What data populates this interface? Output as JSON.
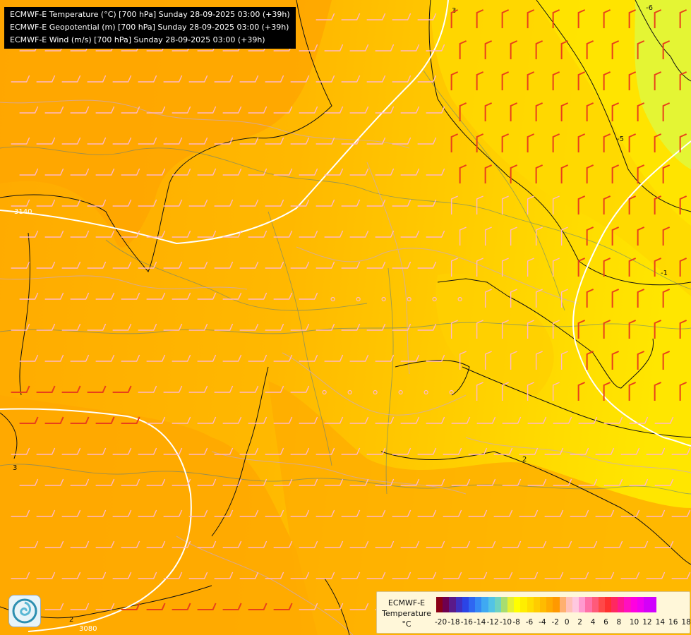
{
  "header": {
    "lines": [
      "ECMWF-E Temperature (°C) [700 hPa] Sunday 28-09-2025 03:00 (+39h)",
      "ECMWF-E Geopotential (m) [700 hPa] Sunday 28-09-2025 03:00 (+39h)",
      "ECMWF-E Wind (m/s) [700 hPa] Sunday 28-09-2025 03:00 (+39h)"
    ]
  },
  "map": {
    "temperature_contour_labels": [
      "3",
      "3",
      "2",
      "2",
      "-1",
      "-5",
      "-6"
    ],
    "geopotential_contour_labels": [
      "3140",
      "3080"
    ],
    "colors": {
      "warm_orange": "#ffa800",
      "orange": "#ffb400",
      "yellow_orange": "#ffcc00",
      "yellow": "#ffe400",
      "yellow_green": "#d9f43a",
      "wind_barb_light": "#ffb8c8",
      "wind_barb_strong": "#e8401a",
      "temperature_isotherm": "#111111",
      "geopotential_isoline": "#ffffff",
      "borders": "#b0a0c0",
      "rivers": "#3a6a8a"
    }
  },
  "legend": {
    "title_line1": "ECMWF-E",
    "title_line2": "Temperature",
    "unit": "°C",
    "ticks": [
      "-20",
      "-18",
      "-16",
      "-14",
      "-12",
      "-10",
      "-8",
      "-6",
      "-4",
      "-2",
      "0",
      "2",
      "4",
      "6",
      "8",
      "10",
      "12",
      "14",
      "16",
      "18"
    ],
    "swatches": [
      "#8b0015",
      "#6e0050",
      "#5a1a8a",
      "#3f2fc0",
      "#2b44e6",
      "#2e66f2",
      "#3488f5",
      "#3fa9f2",
      "#52c3e6",
      "#6fd2c0",
      "#a8dd70",
      "#e5ef34",
      "#ffff00",
      "#ffee00",
      "#ffdd00",
      "#ffcc00",
      "#ffbb00",
      "#ffaa00",
      "#ff9900",
      "#ffb070",
      "#ffc0b8",
      "#ffc8e0",
      "#ff9ad0",
      "#ff70a8",
      "#ff5a7a",
      "#ff4848",
      "#ff3030",
      "#ff2860",
      "#ff1890",
      "#ff10c0",
      "#ff00e0",
      "#ee00f0",
      "#d400f8",
      "#d000ff"
    ]
  }
}
